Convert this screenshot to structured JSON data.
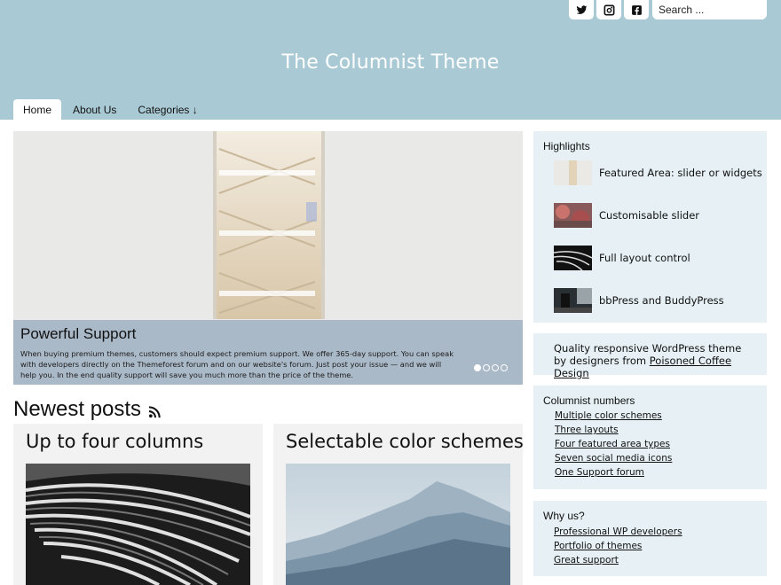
{
  "header": {
    "site_title": "The Columnist Theme",
    "search_placeholder": "Search ...",
    "social": [
      "twitter-icon",
      "instagram-icon",
      "facebook-icon"
    ],
    "colors": {
      "header_bg": "#a9cad5",
      "widget_bg": "#e6f0f5",
      "card_bg": "#f2f2f2"
    }
  },
  "nav": {
    "items": [
      {
        "label": "Home",
        "active": true
      },
      {
        "label": "About Us",
        "active": false
      },
      {
        "label": "Categories ↓",
        "active": false
      }
    ]
  },
  "slider": {
    "title": "Powerful Support",
    "text": "When buying premium themes, customers should expect premium support. We offer 365-day support. You can speak with developers directly on the Themeforest forum and on our website's forum. Just post your issue — and we will help you. In the end quality support will save you much more than the price of the theme.",
    "dots_count": 4,
    "active_dot": 1
  },
  "newest": {
    "title": "Newest posts",
    "icon": "rss-icon",
    "posts": [
      {
        "title": "Up to four columns"
      },
      {
        "title": "Selectable color schemes"
      }
    ]
  },
  "sidebar": {
    "highlights": {
      "title": "Highlights",
      "items": [
        {
          "label": "Featured Area: slider or widgets"
        },
        {
          "label": "Customisable slider"
        },
        {
          "label": "Full layout control"
        },
        {
          "label": "bbPress and BuddyPress"
        }
      ]
    },
    "about": {
      "text": "Quality responsive WordPress theme by designers from ",
      "link": "Poisoned Coffee Design"
    },
    "numbers": {
      "title": "Columnist numbers",
      "links": [
        "Multiple color schemes",
        "Three layouts",
        "Four featured area types",
        "Seven social media icons",
        "One Support forum"
      ]
    },
    "why": {
      "title": "Why us?",
      "links": [
        "Professional WP developers",
        "Portfolio of themes",
        "Great support"
      ]
    }
  }
}
